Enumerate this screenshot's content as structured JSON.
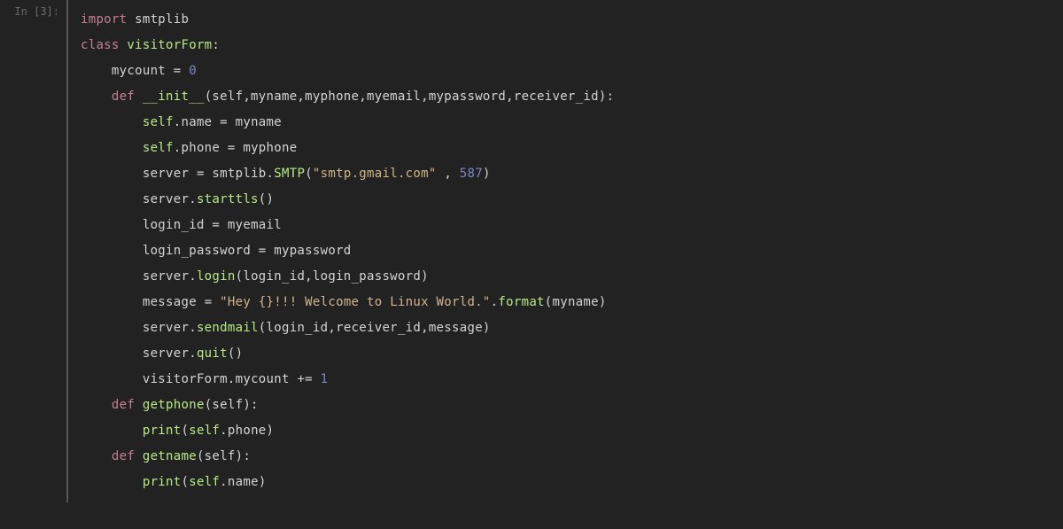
{
  "prompt": "In [3]:",
  "code": {
    "l1": {
      "kw": "import",
      "mod": "smtplib"
    },
    "l2": {
      "kw": "class",
      "name": "visitorForm",
      "colon": ":"
    },
    "l3": {
      "var": "mycount",
      "eq": "=",
      "val": "0"
    },
    "l4": {
      "kw": "def",
      "name": "__init__",
      "params": "(self,myname,myphone,myemail,mypassword,receiver_id):"
    },
    "l5": {
      "self": "self",
      "attr": ".name",
      "eq": "=",
      "rhs": "myname"
    },
    "l6": {
      "self": "self",
      "attr": ".phone",
      "eq": "=",
      "rhs": "myphone"
    },
    "l7": {
      "lhs": "server",
      "eq": "=",
      "mod": "smtplib",
      "dot": ".",
      "call": "SMTP",
      "open": "(",
      "str": "\"smtp.gmail.com\"",
      "comma": " , ",
      "num": "587",
      "close": ")"
    },
    "l8": {
      "obj": "server",
      "dot": ".",
      "call": "starttls",
      "p": "()"
    },
    "l9": {
      "lhs": "login_id",
      "eq": "=",
      "rhs": "myemail"
    },
    "l10": {
      "lhs": "login_password",
      "eq": "=",
      "rhs": "mypassword"
    },
    "l11": {
      "obj": "server",
      "dot": ".",
      "call": "login",
      "args": "(login_id,login_password)"
    },
    "l12": {
      "lhs": "message",
      "eq": "=",
      "str": "\"Hey {}!!! Welcome to Linux World.\"",
      "dot": ".",
      "call": "format",
      "args": "(myname)"
    },
    "l13": {
      "obj": "server",
      "dot": ".",
      "call": "sendmail",
      "args": "(login_id,receiver_id,message)"
    },
    "l14": {
      "obj": "server",
      "dot": ".",
      "call": "quit",
      "p": "()"
    },
    "l15": {
      "obj": "visitorForm",
      "dot": ".",
      "attr": "mycount",
      "op": "+=",
      "val": "1"
    },
    "l16": {
      "kw": "def",
      "name": "getphone",
      "params": "(self):"
    },
    "l17": {
      "call": "print",
      "open": "(",
      "self": "self",
      "attr": ".phone",
      "close": ")"
    },
    "l18": {
      "kw": "def",
      "name": "getname",
      "params": "(self):"
    },
    "l19": {
      "call": "print",
      "open": "(",
      "self": "self",
      "attr": ".name",
      "close": ")"
    }
  }
}
